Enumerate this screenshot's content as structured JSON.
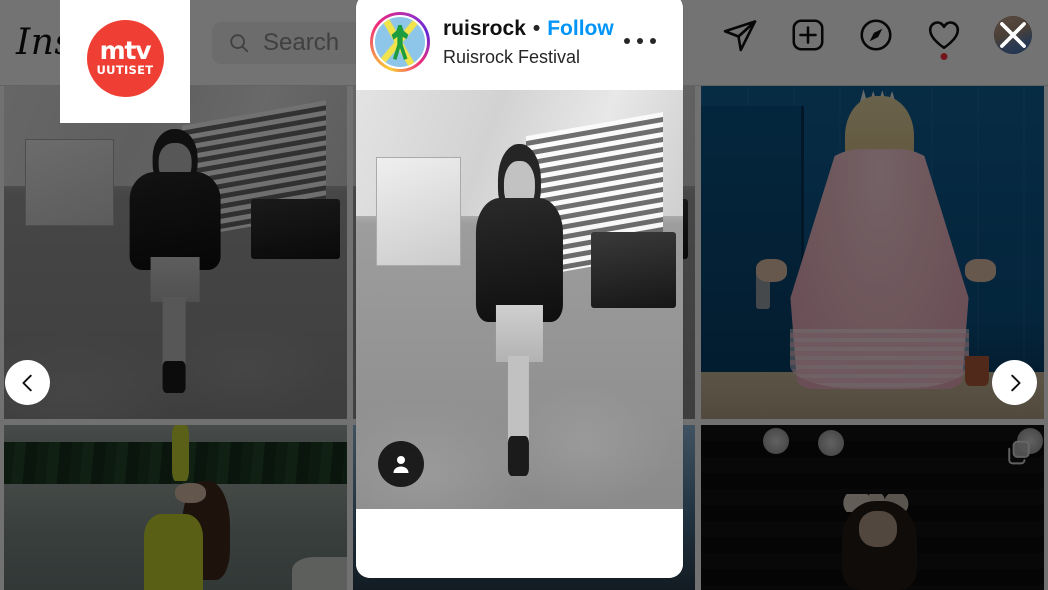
{
  "app": {
    "name": "Instagram",
    "wordmark": "Ins"
  },
  "header": {
    "search": {
      "placeholder": "Search",
      "value": "",
      "icon": "search-icon"
    },
    "icons": [
      {
        "name": "share-icon",
        "label": "Share"
      },
      {
        "name": "new-post-icon",
        "label": "New post"
      },
      {
        "name": "explore-icon",
        "label": "Explore"
      },
      {
        "name": "activity-heart-icon",
        "label": "Notifications",
        "badge": true
      }
    ],
    "profile": {
      "name": "profile-avatar",
      "label": "Profile"
    }
  },
  "watermark": {
    "brand_top": "mtv",
    "brand_bottom": "UUTISET",
    "color": "#ef3e33"
  },
  "modal": {
    "username": "ruisrock",
    "separator": "•",
    "follow_label": "Follow",
    "full_name": "Ruisrock Festival",
    "more_label": "More options",
    "avatar_name": "ruisrock-avatar",
    "tag_badge": "tagged-people-icon",
    "media_alt": "Black and white photo of a woman in leather jacket and denim shorts walking on gravel at a festival"
  },
  "carousel": {
    "prev_label": "Go back",
    "next_label": "Next"
  },
  "close": {
    "label": "Close"
  },
  "grid": {
    "tiles": [
      {
        "name": "post-tile-bw-walk",
        "alt": "Woman walking, black and white"
      },
      {
        "name": "post-tile-pink-dress",
        "alt": "Performer in pink ruffled dress on blue wall"
      },
      {
        "name": "post-tile-lake",
        "alt": "Woman in yellow sweater by a lake"
      },
      {
        "name": "post-tile-dark-stage",
        "alt": "Woman with flower crown on dark stage",
        "carousel": true
      }
    ]
  },
  "colors": {
    "accent_blue": "#0095f6",
    "notification_red": "#ff3040",
    "brand_red": "#ef3e33",
    "text_primary": "#262626",
    "text_secondary": "#8e8e8e"
  }
}
